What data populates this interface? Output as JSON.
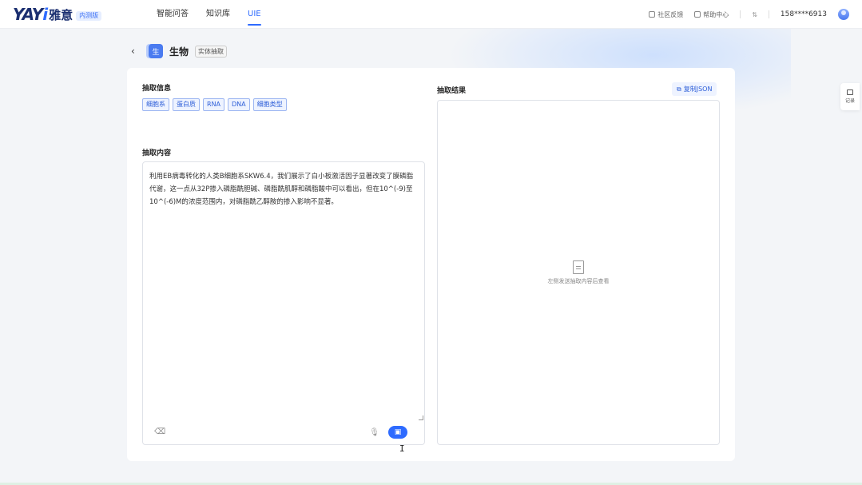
{
  "header": {
    "logo": {
      "mark": "YAYi",
      "name": "雅意",
      "badge": "内测版"
    },
    "nav": [
      {
        "label": "智能问答",
        "active": false
      },
      {
        "label": "知识库",
        "active": false
      },
      {
        "label": "UIE",
        "active": true
      }
    ],
    "right": {
      "feedback": "社区反馈",
      "help": "帮助中心",
      "phone": "158****6913"
    }
  },
  "page": {
    "title": "生物",
    "icon_text": "生",
    "tag": "实体抽取"
  },
  "extract_info": {
    "label": "抽取信息",
    "chips": [
      "细胞系",
      "蛋白质",
      "RNA",
      "DNA",
      "细胞类型"
    ]
  },
  "extract_content": {
    "label": "抽取内容",
    "text": "利用EB病毒转化的人类B细胞系SKW6.4，我们展示了白小板激活因子显著改变了膜磷脂代谢，这一点从32P掺入磷脂酰胆碱、磷脂酰肌醇和磷脂酸中可以看出，但在10^(-9)至10^(-6)M的浓度范围内，对磷脂酰乙醇胺的掺入影响不显著。"
  },
  "result": {
    "label": "抽取结果",
    "copy_label": "复制JSON",
    "empty_text": "左侧发送抽取内容后查看"
  },
  "float_history": {
    "label": "记录"
  },
  "colors": {
    "accent": "#2e6bff",
    "brand": "#1b2f70"
  }
}
